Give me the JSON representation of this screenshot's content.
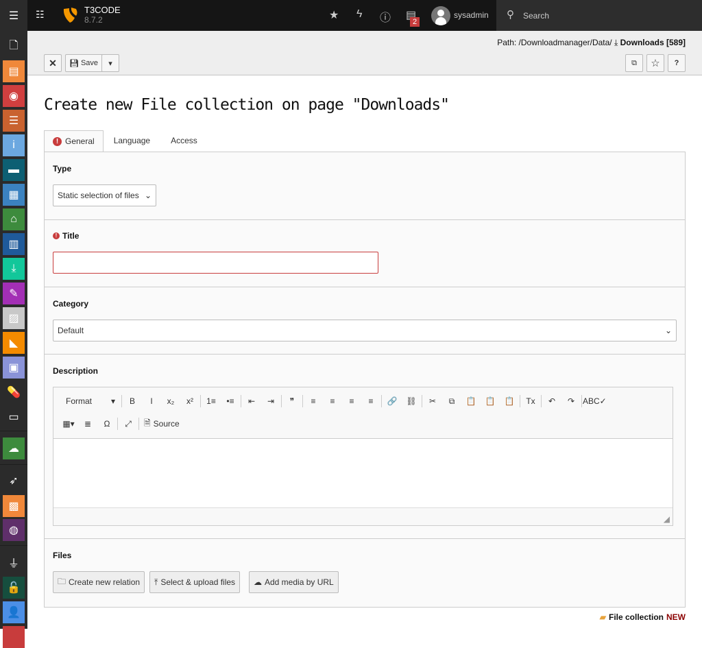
{
  "topbar": {
    "site_name": "T3CODE",
    "version": "8.7.2",
    "username": "sysadmin",
    "search_label": "Search",
    "notification_count": "2",
    "icons": [
      "menu-icon",
      "pagetree-icon",
      "bookmark-star-icon",
      "flash-clear-cache-icon",
      "help-icon",
      "system-info-icon",
      "avatar",
      "search-icon"
    ]
  },
  "sidebar": {
    "modules": [
      {
        "name": "page",
        "color": "#2b2b2b",
        "glyph": "🗋"
      },
      {
        "name": "page-module",
        "color": "#f0883a",
        "glyph": "▤"
      },
      {
        "name": "view",
        "color": "#d03f3f",
        "glyph": "◉"
      },
      {
        "name": "list",
        "color": "#c9622f",
        "glyph": "☰"
      },
      {
        "name": "info",
        "color": "#6ca8e0",
        "glyph": "i"
      },
      {
        "name": "toolbox",
        "color": "#0d5f73",
        "glyph": "▬"
      },
      {
        "name": "news",
        "color": "#3b82c0",
        "glyph": "▦"
      },
      {
        "name": "presentation",
        "color": "#3d8b3d",
        "glyph": "⌂"
      },
      {
        "name": "template",
        "color": "#1f5a9a",
        "glyph": "▥"
      },
      {
        "name": "downloads",
        "color": "#12c79a",
        "glyph": "⤓"
      },
      {
        "name": "form",
        "color": "#a32fb5",
        "glyph": "✎"
      },
      {
        "name": "content",
        "color": "#c8c8c8",
        "glyph": "▨"
      },
      {
        "name": "typo3",
        "color": "#f48b00",
        "glyph": "◣"
      },
      {
        "name": "newsletter",
        "color": "#8a93d8",
        "glyph": "▣"
      },
      {
        "name": "pill",
        "color": "#2b2b2b",
        "glyph": "💊"
      },
      {
        "name": "filelist",
        "color": "#2b2b2b",
        "glyph": "▭"
      },
      {
        "name": "cloud",
        "color": "#3d8b3d",
        "glyph": "☁"
      },
      {
        "name": "rocket",
        "color": "#2b2b2b",
        "glyph": "➶"
      },
      {
        "name": "extension",
        "color": "#f0883a",
        "glyph": "▩"
      },
      {
        "name": "globe",
        "color": "#5f2f6a",
        "glyph": "◍"
      },
      {
        "name": "plug",
        "color": "#2b2b2b",
        "glyph": "⏚"
      },
      {
        "name": "lock",
        "color": "#164e3e",
        "glyph": "🔓"
      },
      {
        "name": "user",
        "color": "#4c8fe6",
        "glyph": "👤"
      },
      {
        "name": "more",
        "color": "#c83c3c",
        "glyph": ""
      }
    ]
  },
  "docheader": {
    "path_label": "Path: /Downloadmanager/Data/",
    "page_title": "Downloads [589]",
    "save_label": "Save",
    "help_label": "?"
  },
  "page_title": "Create new File collection on page \"Downloads\"",
  "tabs": [
    {
      "label": "General",
      "error": true
    },
    {
      "label": "Language"
    },
    {
      "label": "Access"
    }
  ],
  "form": {
    "type": {
      "label": "Type",
      "value": "Static selection of files"
    },
    "title": {
      "label": "Title",
      "value": ""
    },
    "category": {
      "label": "Category",
      "value": "Default"
    },
    "description": {
      "label": "Description",
      "format_label": "Format",
      "source_label": "Source",
      "toolbar_row1": [
        "B",
        "I",
        "x₂",
        "x²",
        "|",
        "1≡",
        "•≡",
        "|",
        "⇤",
        "⇥",
        "|",
        "❞",
        "|",
        "≡",
        "≡",
        "≡",
        "≡",
        "|",
        "🔗",
        "⛓",
        "|",
        "✂",
        "⧉",
        "📋",
        "📋",
        "📋",
        "|",
        "Tx",
        "|",
        "↶",
        "↷",
        "|",
        "ABC✓"
      ],
      "toolbar_row2": [
        "▦▾",
        "≣",
        "Ω",
        "|",
        "⤢",
        "|"
      ]
    },
    "files": {
      "label": "Files",
      "buttons": [
        "Create new relation",
        "Select & upload files",
        "Add media by URL"
      ]
    }
  },
  "footer": {
    "label": "File collection",
    "status": "NEW",
    "status_color": "#8b0000"
  }
}
